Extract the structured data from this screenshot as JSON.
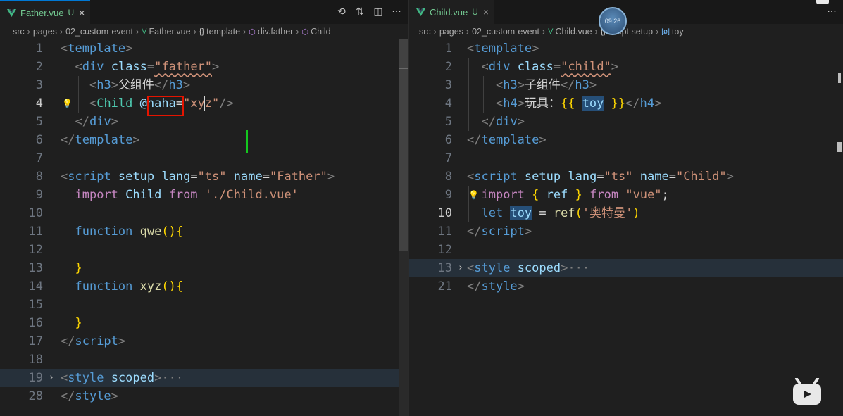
{
  "left": {
    "tab": {
      "name": "Father.vue",
      "status": "U",
      "close": "×"
    },
    "toolbar": {
      "timeline_icon": "history-icon",
      "compare_icon": "compare-changes-icon",
      "split_icon": "split-editor-icon",
      "more": "···"
    },
    "breadcrumb": {
      "src": "src",
      "pages": "pages",
      "folder": "02_custom-event",
      "file": "Father.vue",
      "template": "template",
      "div": "div.father",
      "child": "Child"
    },
    "lines": [
      "1",
      "2",
      "3",
      "4",
      "5",
      "6",
      "7",
      "8",
      "9",
      "10",
      "11",
      "12",
      "13",
      "14",
      "15",
      "16",
      "17",
      "18",
      "19",
      "28"
    ],
    "code": {
      "template_open": "template",
      "div": "div",
      "class_attr": "class",
      "father_str": "\"father\"",
      "h3": "h3",
      "h3_text": "父组件",
      "child_tag": "Child",
      "at": "@",
      "haha": "haha",
      "eq": "=",
      "xyz_str": "\"xyz\"",
      "script": "script",
      "setup": "setup",
      "lang": "lang",
      "ts_str": "\"ts\"",
      "name_attr": "name",
      "father_name": "\"Father\"",
      "import_kw": "import",
      "child_ident": "Child",
      "from_kw": "from",
      "child_path": "'./Child.vue'",
      "function_kw": "function",
      "qwe": "qwe",
      "xyz_fn": "xyz",
      "paren_brace": "(){",
      "close_brace": "}",
      "style": "style",
      "scoped": "scoped",
      "ellipsis": "···"
    }
  },
  "right": {
    "tab": {
      "name": "Child.vue",
      "status": "U",
      "close": "×"
    },
    "more": "···",
    "breadcrumb": {
      "src": "src",
      "pages": "pages",
      "folder": "02_custom-event",
      "file": "Child.vue",
      "script": "script setup",
      "toy": "toy"
    },
    "avatar_time": "09:26",
    "lines": [
      "1",
      "2",
      "3",
      "4",
      "5",
      "6",
      "7",
      "8",
      "9",
      "10",
      "11",
      "12",
      "13",
      "21"
    ],
    "code": {
      "template": "template",
      "div": "div",
      "class_attr": "class",
      "child_str": "\"child\"",
      "h3": "h3",
      "h3_text": "子组件",
      "h4": "h4",
      "h4_text": "玩具：",
      "mustache_open": "{{",
      "toy": "toy",
      "mustache_close": "}}",
      "script": "script",
      "setup": "setup",
      "lang": "lang",
      "ts_str": "\"ts\"",
      "name_attr": "name",
      "child_name": "\"Child\"",
      "import_kw": "import",
      "lbrace": "{",
      "ref": "ref",
      "rbrace": "}",
      "from_kw": "from",
      "vue_str": "\"vue\"",
      "semi": ";",
      "let_kw": "let",
      "eq": " = ",
      "ref_call": "ref",
      "ultraman_str": "'奥特曼'",
      "style": "style",
      "scoped": "scoped",
      "ellipsis": "···"
    }
  },
  "colors": {
    "tag": "#569cd6",
    "attr": "#9cdcfe",
    "string": "#ce9178",
    "keyword": "#c586c0",
    "function": "#dcdcaa",
    "untracked": "#73c991",
    "highlight_box": "#e51400"
  }
}
